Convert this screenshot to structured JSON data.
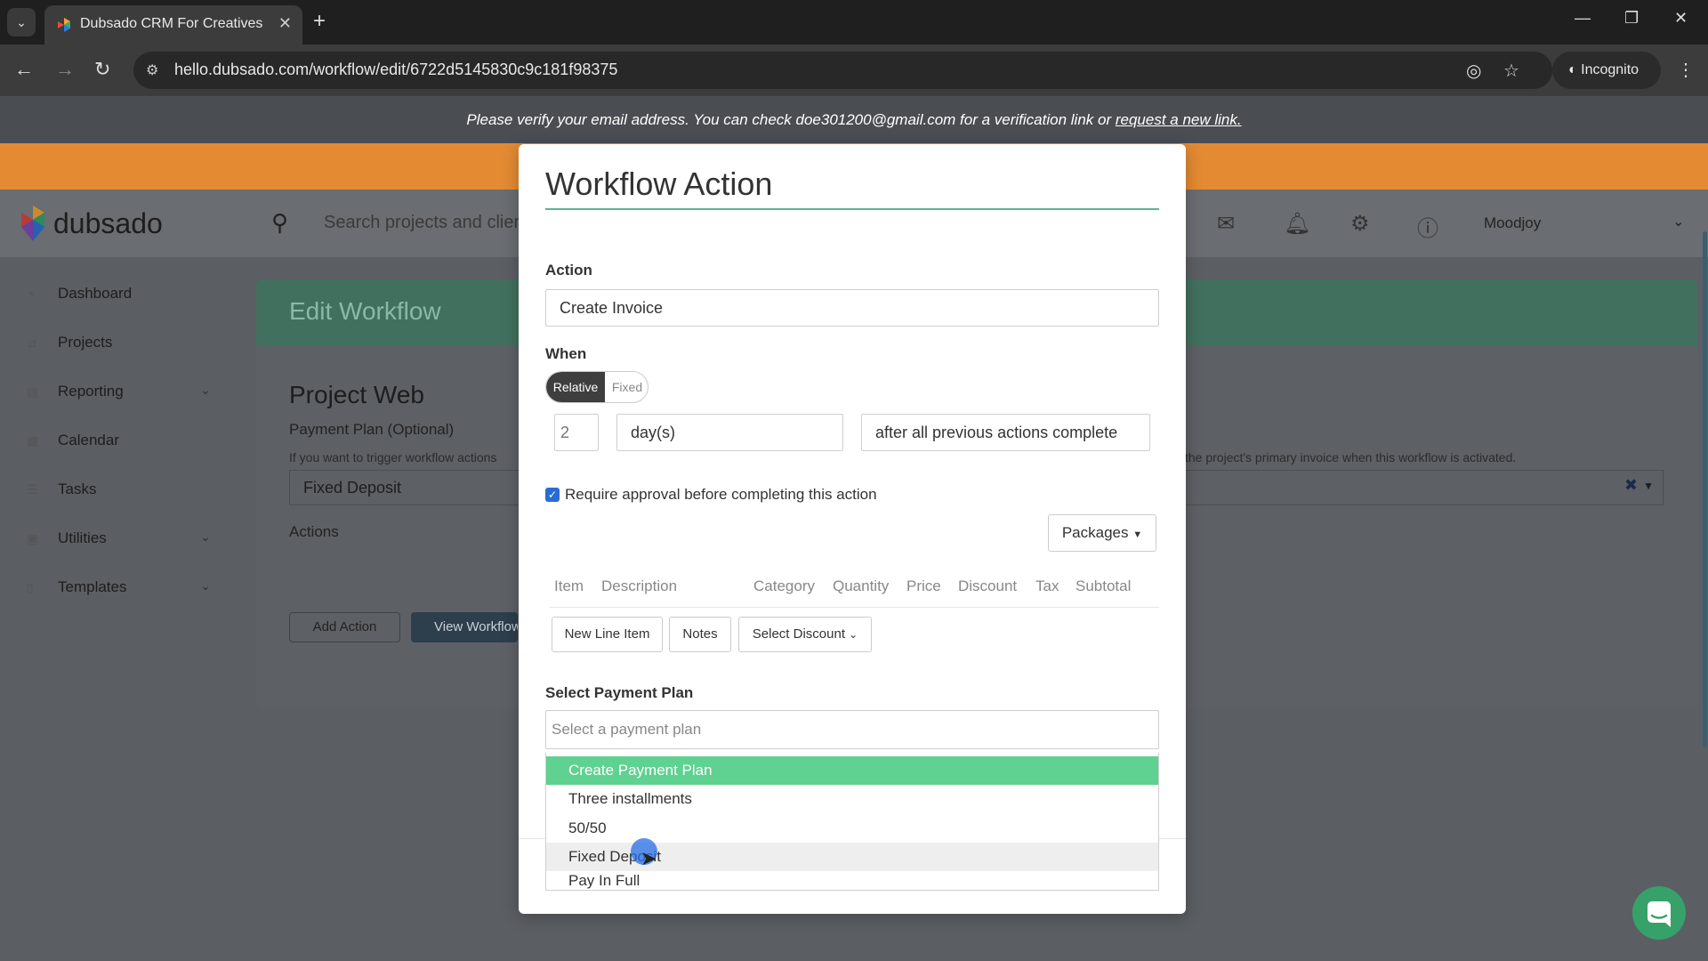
{
  "browser": {
    "tab_title": "Dubsado CRM For Creatives",
    "url": "hello.dubsado.com/workflow/edit/6722d5145830c9c181f98375",
    "incognito_label": "Incognito"
  },
  "banner": {
    "verify_text": "Please verify your email address. You can check doe301200@gmail.com for a verification link or",
    "verify_link": "request a new link."
  },
  "topnav": {
    "brand": "dubsado",
    "search_placeholder": "Search projects and clien",
    "user": "Moodjoy"
  },
  "sidebar": {
    "items": [
      {
        "label": "Dashboard"
      },
      {
        "label": "Projects"
      },
      {
        "label": "Reporting"
      },
      {
        "label": "Calendar"
      },
      {
        "label": "Tasks"
      },
      {
        "label": "Utilities"
      },
      {
        "label": "Templates"
      }
    ]
  },
  "page": {
    "header_title": "Edit Workflow",
    "project_title": "Project Web",
    "payment_plan_label": "Payment Plan (Optional)",
    "payment_plan_help": "If you want to trigger workflow actions",
    "payment_plan_help_right": "the project's primary invoice when this workflow is activated.",
    "payment_plan_value": "Fixed Deposit",
    "actions_label": "Actions",
    "add_action": "Add Action",
    "view_workflow": "View Workflow"
  },
  "modal": {
    "title": "Workflow Action",
    "action_label": "Action",
    "action_value": "Create Invoice",
    "when_label": "When",
    "toggle_on": "Relative",
    "toggle_off": "Fixed",
    "amount": "2",
    "unit": "day(s)",
    "trigger": "after all previous actions complete",
    "approval_label": "Require approval before completing this action",
    "packages_btn": "Packages",
    "columns": [
      "Item",
      "Description",
      "Category",
      "Quantity",
      "Price",
      "Discount",
      "Tax",
      "Subtotal"
    ],
    "new_line_item": "New Line Item",
    "notes": "Notes",
    "select_discount": "Select Discount",
    "payment_plan_label": "Select Payment Plan",
    "payment_plan_placeholder": "Select a payment plan",
    "options": [
      "Create Payment Plan",
      "Three installments",
      "50/50",
      "Fixed Deposit",
      "Pay In Full"
    ]
  },
  "colors": {
    "accent_green": "#5fd190",
    "header_green": "#5fb490",
    "orange": "#e38a33",
    "checkbox_blue": "#2a6cd6"
  }
}
